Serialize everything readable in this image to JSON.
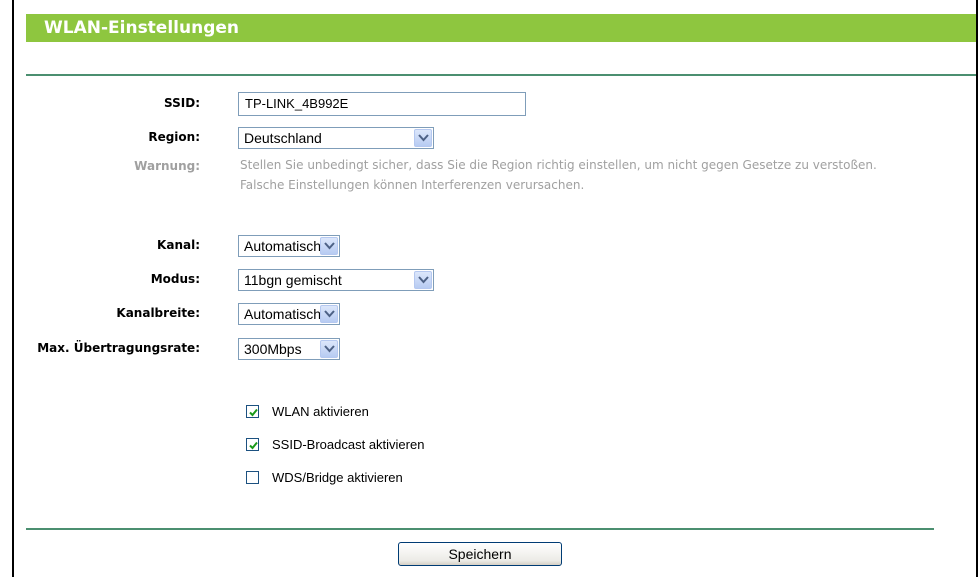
{
  "title": "WLAN-Einstellungen",
  "fields": {
    "ssid": {
      "label": "SSID:",
      "value": "TP-LINK_4B992E"
    },
    "region": {
      "label": "Region:",
      "value": "Deutschland"
    },
    "warning": {
      "label": "Warnung:",
      "line1": "Stellen Sie unbedingt sicher, dass Sie die Region richtig einstellen, um nicht gegen Gesetze zu verstoßen.",
      "line2": "Falsche Einstellungen können Interferenzen verursachen."
    },
    "kanal": {
      "label": "Kanal:",
      "value": "Automatisch"
    },
    "modus": {
      "label": "Modus:",
      "value": "11bgn gemischt"
    },
    "kanalbreite": {
      "label": "Kanalbreite:",
      "value": "Automatisch"
    },
    "rate": {
      "label": "Max. Übertragungsrate:",
      "value": "300Mbps"
    }
  },
  "checkboxes": [
    {
      "label": "WLAN aktivieren",
      "checked": true
    },
    {
      "label": "SSID-Broadcast aktivieren",
      "checked": true
    },
    {
      "label": "WDS/Bridge aktivieren",
      "checked": false
    }
  ],
  "save_label": "Speichern",
  "colors": {
    "title_bg": "#8ec63f",
    "divider": "#4b8f70",
    "check": "#1b9a1b"
  }
}
